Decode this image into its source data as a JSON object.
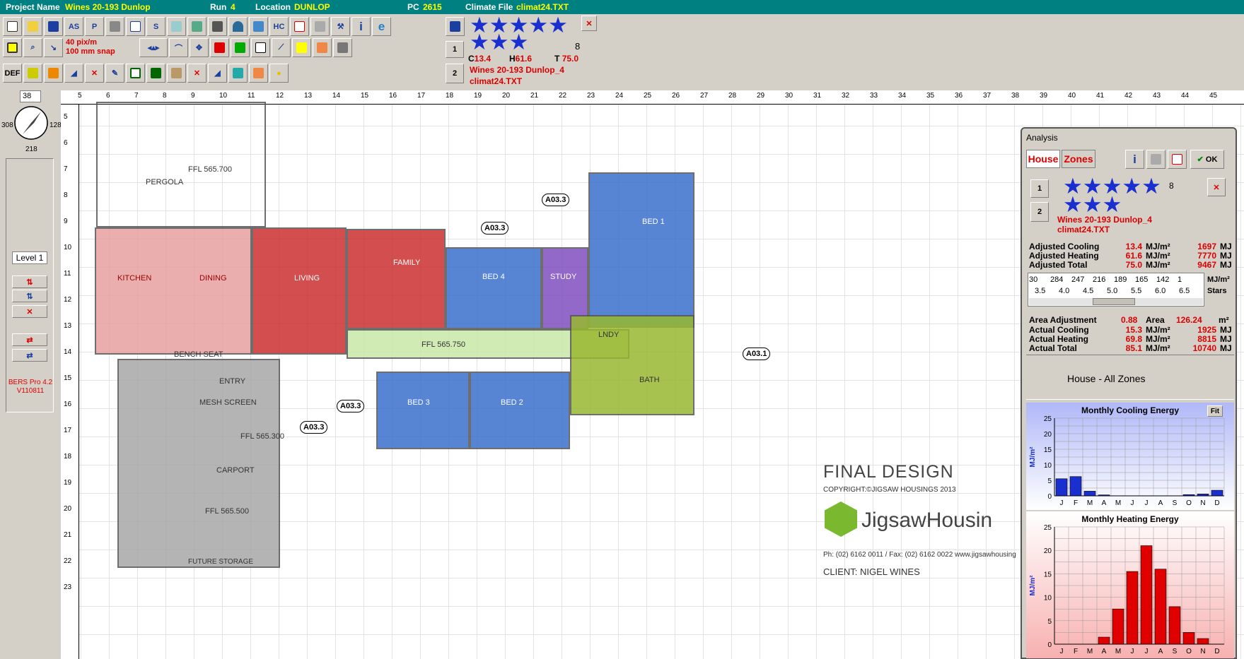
{
  "topbar": {
    "project_label": "Project Name",
    "project": "Wines 20-193 Dunlop",
    "run_label": "Run",
    "run": "4",
    "location_label": "Location",
    "location": "DUNLOP",
    "pc_label": "PC",
    "pc": "2615",
    "climate_label": "Climate File",
    "climate": "climat24.TXT"
  },
  "toolbar": {
    "scale_line1": "40 pix/m",
    "scale_line2": "100 mm snap",
    "def_label": "DEF"
  },
  "stars_panel": {
    "count": "8",
    "c_label": "C",
    "c_val": "13.4",
    "h_label": "H",
    "h_val": "61.6",
    "t_label": "T",
    "t_val": "75.0",
    "zone_up": "1",
    "zone_down": "2",
    "name": "Wines 20-193 Dunlop_4",
    "climate": "climat24.TXT"
  },
  "left": {
    "rotation": "38",
    "compass_left": "308",
    "compass_right": "128",
    "compass_bottom": "218",
    "level": "Level 1",
    "version1": "BERS Pro 4.2",
    "version2": "V110811"
  },
  "canvas": {
    "ruler_x": [
      "5",
      "6",
      "7",
      "8",
      "9",
      "10",
      "11",
      "12",
      "13",
      "14",
      "15",
      "16",
      "17",
      "18",
      "19",
      "20",
      "21",
      "22",
      "23",
      "24",
      "25",
      "26",
      "27",
      "28",
      "29",
      "30",
      "31",
      "32",
      "33",
      "34",
      "35",
      "36",
      "37",
      "38",
      "39",
      "40",
      "41",
      "42",
      "43",
      "44",
      "45"
    ],
    "ruler_y": [
      "5",
      "6",
      "7",
      "8",
      "9",
      "10",
      "11",
      "12",
      "13",
      "14",
      "15",
      "16",
      "17",
      "18",
      "19",
      "20",
      "21",
      "22",
      "23"
    ],
    "labels": {
      "ffl1": "FFL 565.700",
      "pergola": "PERGOLA",
      "kitchen": "KITCHEN",
      "dining": "DINING",
      "living": "LIVING",
      "family": "FAMILY",
      "bed1": "BED 1",
      "bed2": "BED 2",
      "bed3": "BED 3",
      "bed4": "BED 4",
      "study": "STUDY",
      "ffl2": "FFL 565.750",
      "carport": "CARPORT",
      "ffl3": "FFL 565.300",
      "ffl4": "FFL 565.500",
      "entry": "ENTRY",
      "laundry": "LNDY",
      "bath": "BATH",
      "bench": "BENCH SEAT",
      "storage": "FUTURE STORAGE",
      "mesh": "MESH SCREEN",
      "a1": "A03.3",
      "a2": "A03.3",
      "a3": "A03.1",
      "a4": "A03.3",
      "a5": "A03.3",
      "final": "FINAL DESIGN",
      "copyright": "COPYRIGHT:©JIGSAW HOUSINGS 2013",
      "brand": "JigsawHousin",
      "ph": "Ph: (02) 6162 0011 / Fax: (02) 6162 0022 www.jigsawhousing",
      "client": "CLIENT:   NIGEL WINES"
    }
  },
  "analysis": {
    "title": "Analysis",
    "tab_house": "House",
    "tab_zones": "Zones",
    "ok": "OK",
    "zone": "1",
    "zone2": "2",
    "stars": "8",
    "name": "Wines 20-193 Dunlop_4",
    "climate": "climat24.TXT",
    "rows": [
      {
        "label": "Adjusted Cooling",
        "val": "13.4",
        "unit": "MJ/m²",
        "tot": "1697",
        "tunit": "MJ"
      },
      {
        "label": "Adjusted Heating",
        "val": "61.6",
        "unit": "MJ/m²",
        "tot": "7770",
        "tunit": "MJ"
      },
      {
        "label": "Adjusted Total",
        "val": "75.0",
        "unit": "MJ/m²",
        "tot": "9467",
        "tunit": "MJ"
      }
    ],
    "scale_vals": [
      "30",
      "284",
      "247",
      "216",
      "189",
      "165",
      "142",
      "1"
    ],
    "scale_unit": "MJ/m²",
    "scale_stars": [
      "3.5",
      "4.0",
      "4.5",
      "5.0",
      "5.5",
      "6.0",
      "6.5"
    ],
    "stars_label": "Stars",
    "area_adj_label": "Area Adjustment",
    "area_adj": "0.88",
    "area_label": "Area",
    "area": "126.24",
    "area_unit": "m²",
    "rows2": [
      {
        "label": "Actual Cooling",
        "val": "15.3",
        "unit": "MJ/m²",
        "tot": "1925",
        "tunit": "MJ"
      },
      {
        "label": "Actual Heating",
        "val": "69.8",
        "unit": "MJ/m²",
        "tot": "8815",
        "tunit": "MJ"
      },
      {
        "label": "Actual Total",
        "val": "85.1",
        "unit": "MJ/m²",
        "tot": "10740",
        "tunit": "MJ"
      }
    ],
    "zone_title": "House - All Zones",
    "fit": "Fit"
  },
  "chart_data": [
    {
      "type": "bar",
      "title": "Monthly Cooling Energy",
      "ylabel": "MJ/m²",
      "categories": [
        "J",
        "F",
        "M",
        "A",
        "M",
        "J",
        "J",
        "A",
        "S",
        "O",
        "N",
        "D"
      ],
      "values": [
        5.5,
        6.2,
        1.5,
        0.3,
        0,
        0,
        0,
        0,
        0,
        0.4,
        0.6,
        1.8
      ],
      "ylim": [
        0,
        25
      ],
      "yticks": [
        "0",
        "5",
        "10",
        "15",
        "20",
        "25"
      ],
      "color": "#1a2fd0"
    },
    {
      "type": "bar",
      "title": "Monthly Heating Energy",
      "ylabel": "MJ/m²",
      "categories": [
        "J",
        "F",
        "M",
        "A",
        "M",
        "J",
        "J",
        "A",
        "S",
        "O",
        "N",
        "D"
      ],
      "values": [
        0,
        0,
        0,
        1.5,
        7.5,
        15.5,
        21,
        16,
        8,
        2.5,
        1.2,
        0
      ],
      "ylim": [
        0,
        25
      ],
      "yticks": [
        "0",
        "5",
        "10",
        "15",
        "20",
        "25"
      ],
      "color": "#e00000"
    }
  ]
}
